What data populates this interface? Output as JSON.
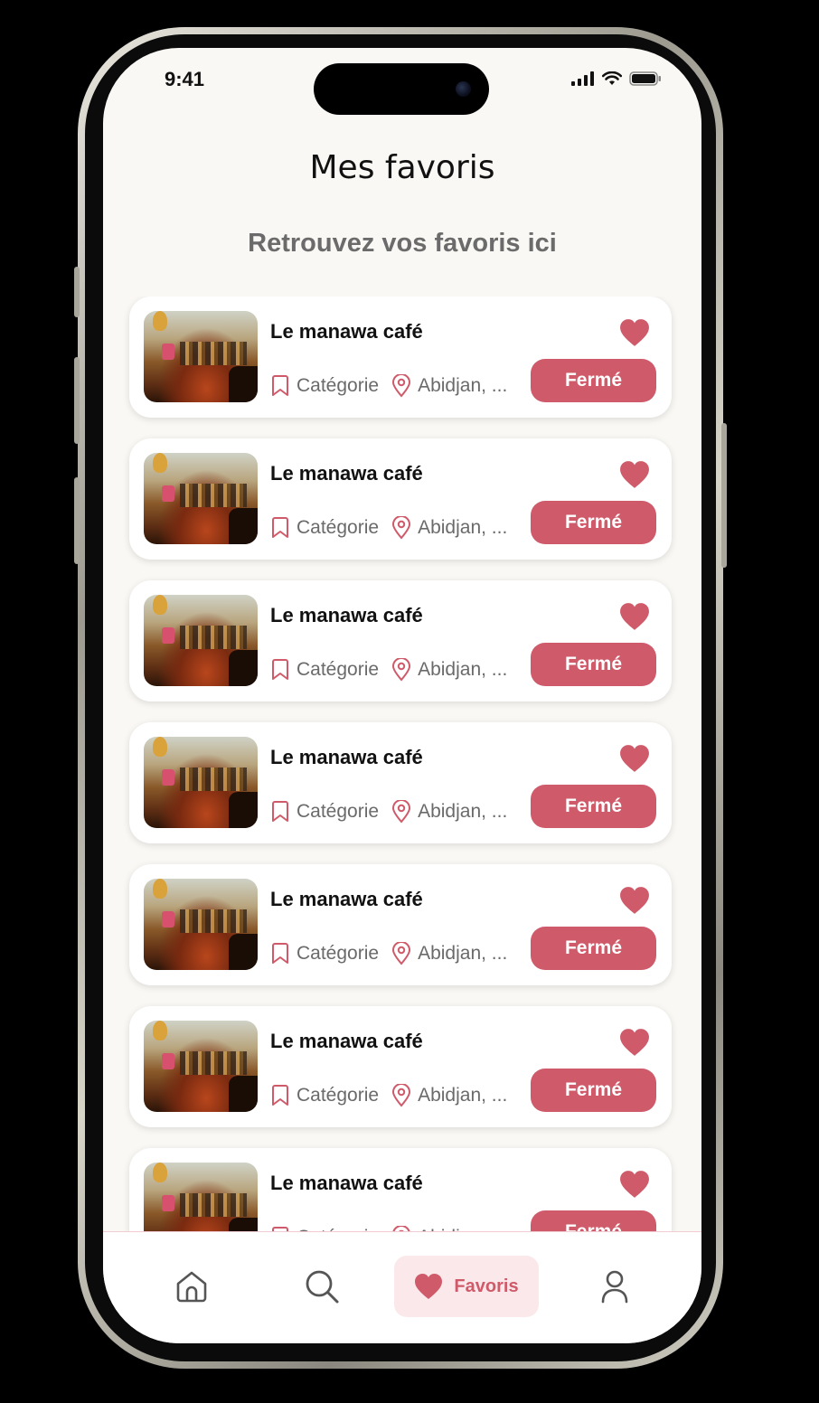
{
  "status_bar": {
    "time": "9:41"
  },
  "header": {
    "title": "Mes favoris",
    "subtitle": "Retrouvez vos favoris ici"
  },
  "favorites": [
    {
      "name": "Le manawa café",
      "category": "Catégorie",
      "location": "Abidjan, ...",
      "status": "Fermé"
    },
    {
      "name": "Le manawa café",
      "category": "Catégorie",
      "location": "Abidjan, ...",
      "status": "Fermé"
    },
    {
      "name": "Le manawa café",
      "category": "Catégorie",
      "location": "Abidjan, ...",
      "status": "Fermé"
    },
    {
      "name": "Le manawa café",
      "category": "Catégorie",
      "location": "Abidjan, ...",
      "status": "Fermé"
    },
    {
      "name": "Le manawa café",
      "category": "Catégorie",
      "location": "Abidjan, ...",
      "status": "Fermé"
    },
    {
      "name": "Le manawa café",
      "category": "Catégorie",
      "location": "Abidjan, ...",
      "status": "Fermé"
    },
    {
      "name": "Le manawa café",
      "category": "Catégorie",
      "location": "Abidjan, ...",
      "status": "Fermé"
    }
  ],
  "tabbar": {
    "items": [
      {
        "icon": "home-icon"
      },
      {
        "icon": "search-icon"
      },
      {
        "icon": "heart-icon",
        "label": "Favoris",
        "active": true
      },
      {
        "icon": "user-icon"
      }
    ]
  },
  "colors": {
    "accent": "#cf5a6a",
    "accent_light": "#fbe8eb",
    "background": "#faf8f4",
    "card": "#ffffff"
  }
}
